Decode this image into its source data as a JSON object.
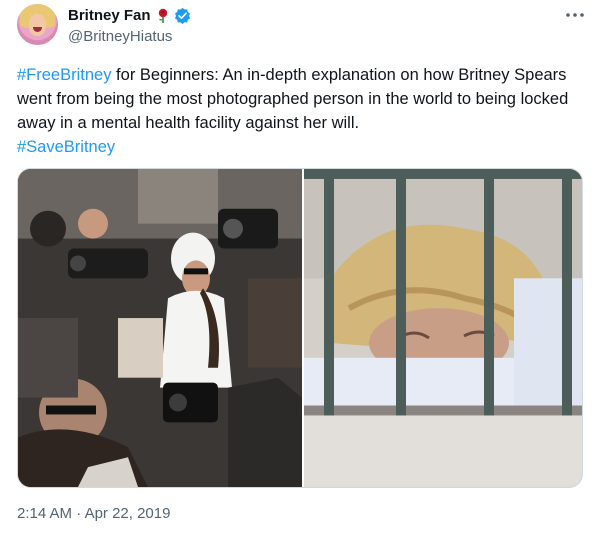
{
  "tweet": {
    "author": {
      "display_name": "Britney Fan",
      "handle": "@BritneyHiatus",
      "emoji_icon": "rose-icon",
      "verified_icon": "verified-badge-icon",
      "verified_color": "#1d9bf0"
    },
    "text": {
      "hashtag1": "#FreeBritney",
      "body": " for Beginners: An in-depth explanation on how Britney Spears went from being the most photographed person in the world to being locked away in a mental health facility against her will.",
      "hashtag2": "#SaveBritney"
    },
    "media": [
      {
        "icon": "paparazzi-crowd-photo"
      },
      {
        "icon": "barred-window-photo"
      }
    ],
    "time": "2:14 AM",
    "separator": " · ",
    "date": "Apr 22, 2019",
    "link_color": "#1d9bf0",
    "more_icon": "more-options-icon"
  }
}
